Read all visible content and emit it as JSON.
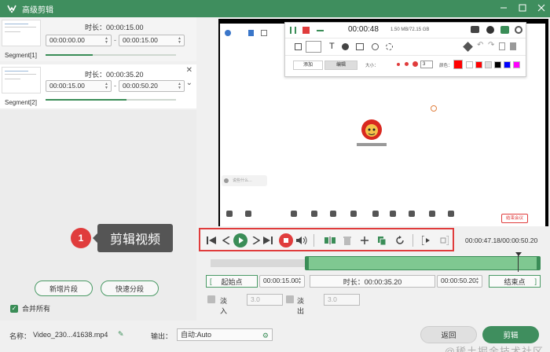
{
  "titlebar": {
    "title": "高级剪辑"
  },
  "segments": [
    {
      "label": "Segment[1]",
      "duration": "时长：00:00:15.00",
      "start": "00:00:00.00",
      "end": "00:00:15.00"
    },
    {
      "label": "Segment[2]",
      "duration": "时长：00:00:35.20",
      "start": "00:00:15.00",
      "end": "00:00:50.20"
    }
  ],
  "segment_progress": [
    0.36,
    0.62
  ],
  "dash": "-",
  "callout": {
    "number": "1",
    "text": "剪辑视频"
  },
  "left_actions": {
    "add_segment": "新增片段",
    "quick_split": "快速分段",
    "merge_all": "合并所有"
  },
  "preview": {
    "rec_time": "00:00:48",
    "rec_size": "1.50 MB/72.15 GB",
    "tab_add": "添加",
    "tab_edit": "编辑",
    "size_label": "大小：",
    "size_value": "3",
    "color_label": "颜色：",
    "swatches": [
      "#ff0000",
      "#ffffff",
      "#ff0000",
      "#e0e0e0",
      "#000000",
      "#0000ff",
      "#ff00ff",
      "#ffff00"
    ],
    "end_meeting": "结束会议",
    "chat_hint": "说些什么…"
  },
  "controls": {
    "time_status": "00:00:47.18/00:00:50.20"
  },
  "timeline": {
    "selection_start_fraction": 0.285,
    "playhead_fraction": 0.93
  },
  "trim": {
    "start_btn": "起始点",
    "start_value": "00:00:15.00",
    "duration_label": "时长：00:00:35.20",
    "end_value": "00:00:50.20",
    "end_btn": "结束点"
  },
  "fade": {
    "fade_in_label": "淡入",
    "fade_in_value": "3.0",
    "fade_out_label": "淡出",
    "fade_out_value": "3.0"
  },
  "bottom": {
    "name_label": "名称：",
    "name_value": "Video_230...41638.mp4",
    "output_label": "输出：",
    "output_value": "自动:Auto",
    "back_btn": "返回",
    "cut_btn": "剪辑"
  },
  "watermark": "@稀土掘金技术社区",
  "colors": {
    "brand": "#3f8e5e",
    "highlight": "#e03c3c",
    "selection": "#7fc891"
  }
}
